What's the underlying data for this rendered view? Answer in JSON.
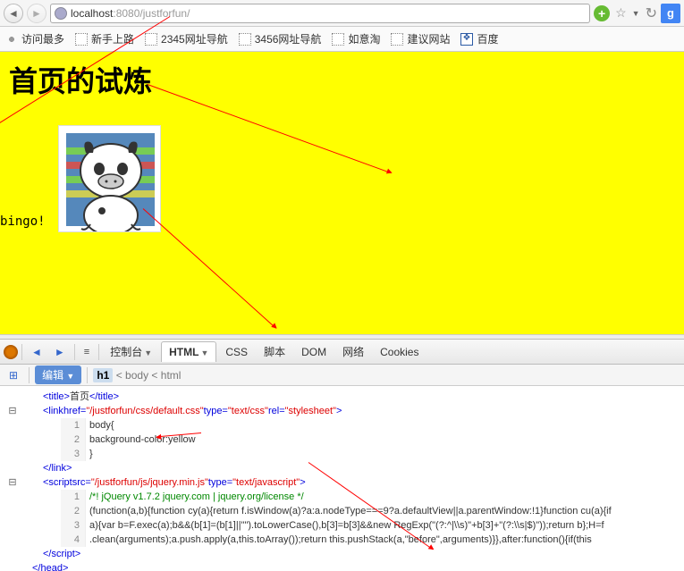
{
  "address_bar": {
    "scheme": "",
    "host": "localhost",
    "port": ":8080",
    "path": "/justforfun/"
  },
  "bookmarks": {
    "label_most": "访问最多",
    "items": [
      "新手上路",
      "2345网址导航",
      "3456网址导航",
      "如意淘",
      "建议网站",
      "百度"
    ]
  },
  "page": {
    "h1": "首页的试炼",
    "bingo": "bingo!"
  },
  "firebug": {
    "tabs": {
      "console": "控制台",
      "html": "HTML",
      "css": "CSS",
      "script": "脚本",
      "dom": "DOM",
      "net": "网络",
      "cookies": "Cookies"
    },
    "crumb": {
      "edit": "编辑",
      "h1": "h1",
      "body": "body",
      "html": "html"
    }
  },
  "source": {
    "title_open": "<title>",
    "title_text": " 首页 ",
    "title_close": "</title>",
    "link_tag": "<link",
    "link_href_attr": " href=",
    "link_href_val": "\"/justforfun/css/default.css\"",
    "type_attr": " type=",
    "css_type_val": "\"text/css\"",
    "rel_attr": " rel=",
    "rel_val": "\"stylesheet\"",
    "tag_close": ">",
    "css_l1": "body{",
    "css_l2": " background-color:yellow",
    "css_l3": "}",
    "link_close": "</link>",
    "script_tag": "<script",
    "src_attr": " src=",
    "src_val": "\"/justforfun/js/jquery.min.js\"",
    "js_type_val": "\"text/javascript\"",
    "js_l1": "/*! jQuery v1.7.2 jquery.com | jquery.org/license */",
    "js_l2": "(function(a,b){function cy(a){return f.isWindow(a)?a:a.nodeType===9?a.defaultView||a.parentWindow:!1}function cu(a){if",
    "js_l3": "a){var b=F.exec(a);b&&(b[1]=(b[1]||\"\").toLowerCase(),b[3]=b[3]&&new RegExp(\"(?:^|\\\\s)\"+b[3]+\"(?:\\\\s|$)\"));return b};H=f",
    "js_l4": ".clean(arguments);a.push.apply(a,this.toArray());return this.pushStack(a,\"before\",arguments)}},after:function(){if(this",
    "script_close_tag": "</script>",
    "head_close": "</head>",
    "line_nums": [
      "1",
      "2",
      "3",
      "1",
      "2",
      "3",
      "4"
    ]
  }
}
